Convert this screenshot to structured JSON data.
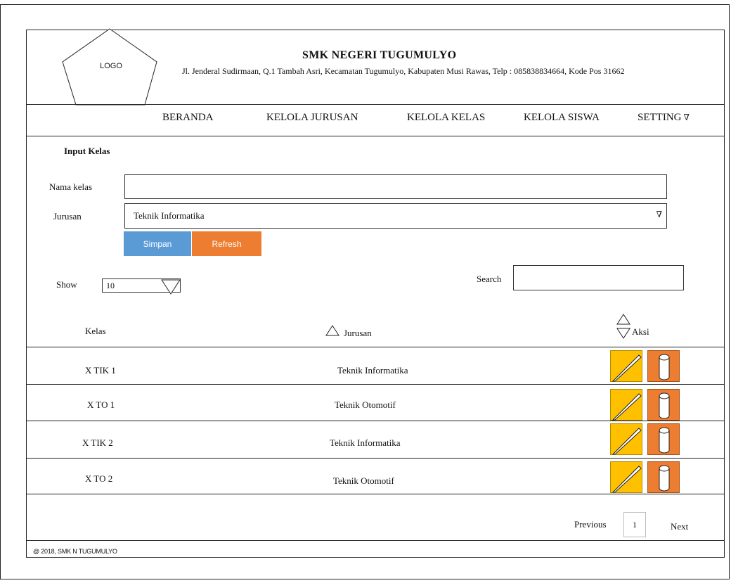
{
  "header": {
    "logo_label": "LOGO",
    "school_name": "SMK NEGERI TUGUMULYO",
    "address": "Jl. Jenderal Sudirmaan, Q.1 Tambah Asri, Kecamatan Tugumulyo, Kabupaten Musi Rawas, Telp : 085838834664, Kode Pos 31662"
  },
  "nav": {
    "beranda": "BERANDA",
    "kelola_jurusan": "KELOLA JURUSAN",
    "kelola_kelas": "KELOLA KELAS",
    "kelola_siswa": "KELOLA SISWA",
    "setting": "SETTING",
    "setting_caret": "∇"
  },
  "form": {
    "title": "Input Kelas",
    "nama_kelas_label": "Nama kelas",
    "nama_kelas_value": "",
    "jurusan_label": "Jurusan",
    "jurusan_value": "Teknik Informatika",
    "select_arrow": "∇",
    "save_label": "Simpan",
    "refresh_label": "Refresh"
  },
  "table_controls": {
    "show_label": "Show",
    "show_value": "10",
    "search_label": "Search",
    "search_value": ""
  },
  "table": {
    "headers": {
      "kelas": "Kelas",
      "jurusan": "Jurusan",
      "aksi": "Aksi"
    },
    "rows": [
      {
        "kelas": "X TIK 1",
        "jurusan": "Teknik Informatika"
      },
      {
        "kelas": "X TO 1",
        "jurusan": "Teknik Otomotif"
      },
      {
        "kelas": "X TIK 2",
        "jurusan": "Teknik Informatika"
      },
      {
        "kelas": "X TO 2",
        "jurusan": "Teknik Otomotif"
      }
    ]
  },
  "pagination": {
    "previous": "Previous",
    "page": "1",
    "next": "Next"
  },
  "footer": {
    "text": "@ 2018, SMK N TUGUMULYO"
  },
  "colors": {
    "save_button": "#5b9bd5",
    "refresh_button": "#ed7d31",
    "edit_action": "#ffc000",
    "delete_action": "#ed7d31"
  }
}
